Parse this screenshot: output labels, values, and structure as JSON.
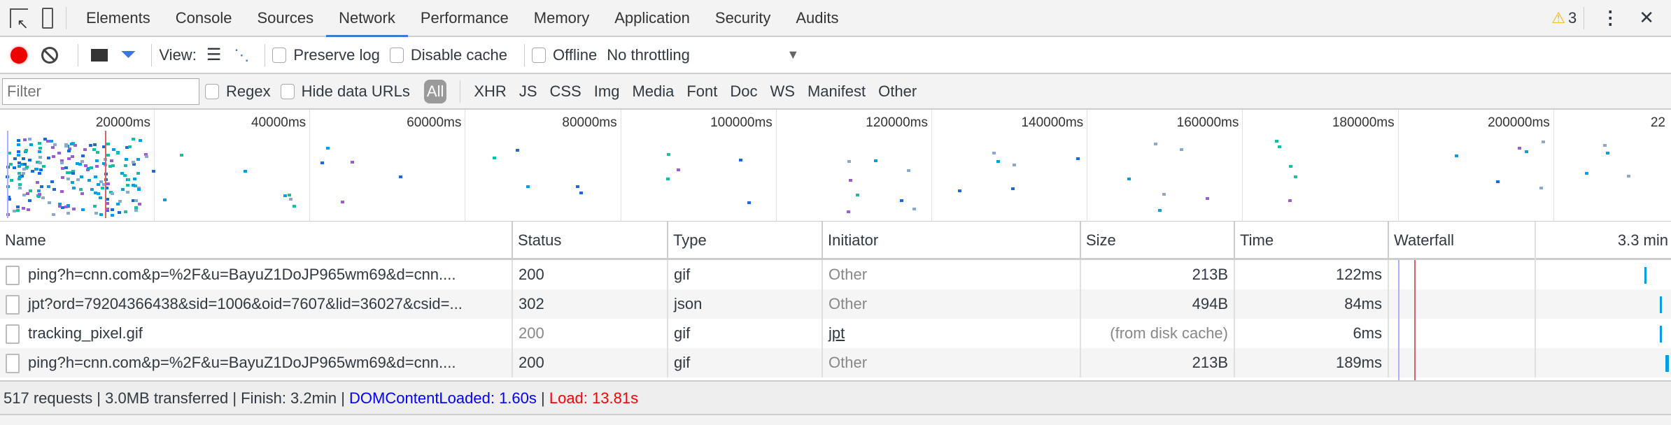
{
  "tabs": [
    "Elements",
    "Console",
    "Sources",
    "Network",
    "Performance",
    "Memory",
    "Application",
    "Security",
    "Audits"
  ],
  "active_tab": "Network",
  "warning_count": "3",
  "toolbar": {
    "view_label": "View:",
    "preserve_log": "Preserve log",
    "disable_cache": "Disable cache",
    "offline": "Offline",
    "throttling": "No throttling"
  },
  "filter": {
    "placeholder": "Filter",
    "regex": "Regex",
    "hide_data_urls": "Hide data URLs",
    "types": [
      "All",
      "XHR",
      "JS",
      "CSS",
      "Img",
      "Media",
      "Font",
      "Doc",
      "WS",
      "Manifest",
      "Other"
    ]
  },
  "overview": {
    "ticks": [
      "20000ms",
      "40000ms",
      "60000ms",
      "80000ms",
      "100000ms",
      "120000ms",
      "140000ms",
      "160000ms",
      "180000ms",
      "200000ms",
      "22"
    ]
  },
  "table": {
    "headers": [
      "Name",
      "Status",
      "Type",
      "Initiator",
      "Size",
      "Time",
      "Waterfall"
    ],
    "waterfall_scale": "3.3 min",
    "rows": [
      {
        "name": "ping?h=cnn.com&p=%2F&u=BayuZ1DoJP965wm69&d=cnn....",
        "status": "200",
        "type": "gif",
        "initiator": "Other",
        "size": "213B",
        "time": "122ms"
      },
      {
        "name": "jpt?ord=79204366438&sid=1006&oid=7607&lid=36027&csid=...",
        "status": "302",
        "type": "json",
        "initiator": "Other",
        "size": "494B",
        "time": "84ms"
      },
      {
        "name": "tracking_pixel.gif",
        "status": "200",
        "type": "gif",
        "initiator": "jpt",
        "size": "(from disk cache)",
        "time": "6ms"
      },
      {
        "name": "ping?h=cnn.com&p=%2F&u=BayuZ1DoJP965wm69&d=cnn....",
        "status": "200",
        "type": "gif",
        "initiator": "Other",
        "size": "213B",
        "time": "189ms"
      }
    ]
  },
  "footer": {
    "summary": "517 requests | 3.0MB transferred | Finish: 3.2min | ",
    "dcl": "DOMContentLoaded: 1.60s",
    "sep": " | ",
    "load": "Load: 13.81s"
  },
  "colors": {
    "accent": "#3879d9",
    "record": "#e00",
    "dcl": "#0000ff",
    "load": "#ff0000",
    "bar": "#00a0e9"
  }
}
